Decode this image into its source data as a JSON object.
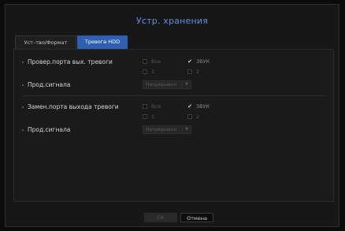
{
  "dialog": {
    "title": "Устр. хранения"
  },
  "tabs": [
    {
      "label": "Уст–тво/Формат",
      "active": false
    },
    {
      "label": "Тревога HDD",
      "active": true
    }
  ],
  "sections": [
    {
      "port_label": "Провер.порта вых. тревоги",
      "checkboxes": [
        {
          "label": "Все",
          "checked": false
        },
        {
          "label": "ЗВУК",
          "checked": true
        },
        {
          "label": "1",
          "checked": false
        },
        {
          "label": "2",
          "checked": false
        }
      ],
      "signal_label": "Прод.сигнала",
      "signal_value": "Непрерывно"
    },
    {
      "port_label": "Замен.порта выхода тревоги",
      "checkboxes": [
        {
          "label": "Все",
          "checked": false
        },
        {
          "label": "ЗВУК",
          "checked": true
        },
        {
          "label": "1",
          "checked": false
        },
        {
          "label": "2",
          "checked": false
        }
      ],
      "signal_label": "Прод.сигнала",
      "signal_value": "Непрерывно"
    }
  ],
  "buttons": {
    "ok": "OK",
    "cancel": "Отмена"
  },
  "colors": {
    "accent": "#5d8fe0",
    "active_tab": "#2f5fb0",
    "background": "#171717"
  },
  "icons": {
    "check": "check-mark-icon",
    "dropdown": "chevron-down-icon"
  }
}
